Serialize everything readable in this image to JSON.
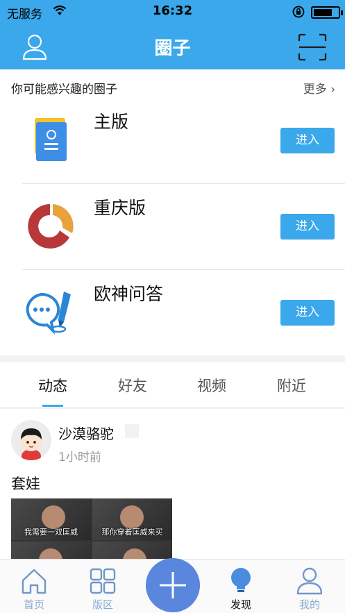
{
  "status_bar": {
    "carrier": "无服务",
    "time": "16:32",
    "battery_level": 0.75
  },
  "nav": {
    "title": "圈子"
  },
  "suggest": {
    "header": "你可能感兴趣的圈子",
    "more": "更多",
    "items": [
      {
        "name": "主版",
        "button": "进入"
      },
      {
        "name": "重庆版",
        "button": "进入"
      },
      {
        "name": "欧神问答",
        "button": "进入"
      }
    ]
  },
  "tabs": [
    {
      "label": "动态",
      "active": true
    },
    {
      "label": "好友"
    },
    {
      "label": "视频"
    },
    {
      "label": "附近"
    }
  ],
  "post": {
    "author": "沙漠骆驼",
    "time": "1小时前",
    "text": "套娃",
    "image_captions": [
      "我需要一双匡威",
      "那你穿着匡威来买"
    ]
  },
  "tabbar": [
    {
      "label": "首页",
      "icon": "home-icon"
    },
    {
      "label": "版区",
      "icon": "grid-icon"
    },
    {
      "label": "",
      "icon": "plus-icon"
    },
    {
      "label": "发现",
      "icon": "bulb-icon",
      "active": true
    },
    {
      "label": "我的",
      "icon": "person-icon"
    }
  ],
  "colors": {
    "primary": "#3aa8ea",
    "fab": "#5a86dd",
    "tab_inactive": "#8aa9cf"
  }
}
